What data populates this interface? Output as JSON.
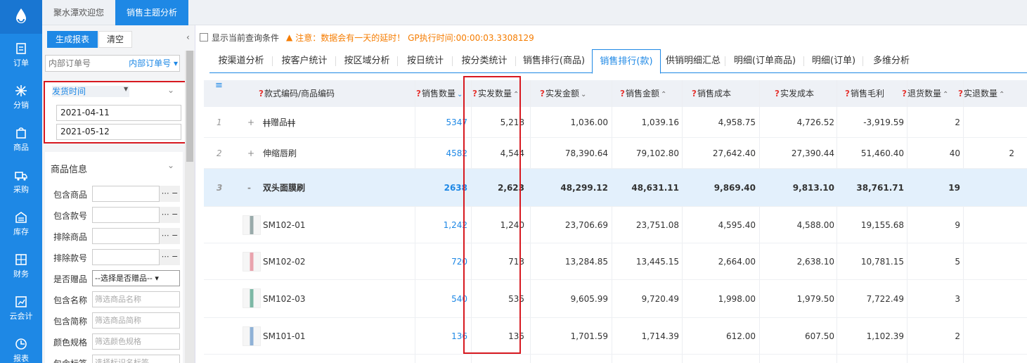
{
  "rail": {
    "items": [
      {
        "label": "订单",
        "icon": "order-icon"
      },
      {
        "label": "分销",
        "icon": "distribution-icon"
      },
      {
        "label": "商品",
        "icon": "product-icon"
      },
      {
        "label": "采购",
        "icon": "truck-icon"
      },
      {
        "label": "库存",
        "icon": "warehouse-icon"
      },
      {
        "label": "财务",
        "icon": "finance-icon"
      },
      {
        "label": "云会计",
        "icon": "accounting-icon"
      },
      {
        "label": "报表",
        "icon": "report-icon"
      }
    ]
  },
  "tabs": [
    "聚水潭欢迎您",
    "销售主题分析"
  ],
  "panel": {
    "generate_label": "生成报表",
    "clear_label": "清空",
    "order_placeholder": "内部订单号",
    "order_select": "内部订单号",
    "date_label": "发货时间",
    "date_from": "2021-04-11",
    "date_to": "2021-05-12",
    "product_info": "商品信息",
    "filters": [
      {
        "label": "包含商品",
        "placeholder": ""
      },
      {
        "label": "包含款号",
        "placeholder": ""
      },
      {
        "label": "排除商品",
        "placeholder": ""
      },
      {
        "label": "排除款号",
        "placeholder": ""
      },
      {
        "label": "是否赠品",
        "select": "--选择是否赠品--"
      },
      {
        "label": "包含名称",
        "placeholder": "筛选商品名称"
      },
      {
        "label": "包含简称",
        "placeholder": "筛选商品简称"
      },
      {
        "label": "颜色规格",
        "placeholder": "筛选颜色规格"
      },
      {
        "label": "包含标签",
        "placeholder": "选择标识名标签"
      }
    ]
  },
  "notice": {
    "checkbox_label": "显示当前查询条件",
    "warning": "注意：数据会有一天的延时！ GP执行时间:00:00:03.3308129"
  },
  "subtabs": [
    "按渠道分析",
    "按客户统计",
    "按区域分析",
    "按日统计",
    "按分类统计",
    "销售排行(商品)",
    "销售排行(款)",
    "供销明细汇总",
    "明细(订单商品)",
    "明细(订单)",
    "多维分析"
  ],
  "active_subtab": "销售排行(款)",
  "columns": [
    {
      "label": "款式编码/商品编码",
      "q": true
    },
    {
      "label": "销售数量",
      "q": true,
      "sort": "desc"
    },
    {
      "label": "实发数量",
      "q": true,
      "sort": "asc"
    },
    {
      "label": "实发金额",
      "q": true,
      "sort": "desc"
    },
    {
      "label": "销售金额",
      "q": true,
      "sort": "asc"
    },
    {
      "label": "销售成本",
      "q": true
    },
    {
      "label": "实发成本",
      "q": true
    },
    {
      "label": "销售毛利",
      "q": true
    },
    {
      "label": "退货数量",
      "q": true,
      "sort": "asc"
    },
    {
      "label": "实退数量",
      "q": true,
      "sort": "asc"
    }
  ],
  "rows": [
    {
      "idx": "1",
      "expand": "+",
      "code": "ǂǂ赠品ǂǂ",
      "sales_qty": "5347",
      "ship_qty": "5,218",
      "ship_amt": "1,036.00",
      "sales_amt": "1,039.16",
      "sales_cost": "4,958.75",
      "ship_cost": "4,726.52",
      "profit": "-3,919.59",
      "return_qty": "2",
      "real_return": ""
    },
    {
      "idx": "2",
      "expand": "+",
      "code": "伸缩唇刷",
      "sales_qty": "4582",
      "ship_qty": "4,544",
      "ship_amt": "78,390.64",
      "sales_amt": "79,102.80",
      "sales_cost": "27,642.40",
      "ship_cost": "27,390.44",
      "profit": "51,460.40",
      "return_qty": "40",
      "real_return": "2"
    },
    {
      "idx": "3",
      "expand": "-",
      "code": "双头面膜刷",
      "sales_qty": "2638",
      "ship_qty": "2,623",
      "ship_amt": "48,299.12",
      "sales_amt": "48,631.11",
      "sales_cost": "9,869.40",
      "ship_cost": "9,813.10",
      "profit": "38,761.71",
      "return_qty": "19",
      "real_return": ""
    },
    {
      "idx": "",
      "expand": "",
      "code": "SM102-01",
      "sales_qty": "1,242",
      "ship_qty": "1,240",
      "ship_amt": "23,706.69",
      "sales_amt": "23,751.08",
      "sales_cost": "4,595.40",
      "ship_cost": "4,588.00",
      "profit": "19,155.68",
      "return_qty": "9",
      "real_return": ""
    },
    {
      "idx": "",
      "expand": "",
      "code": "SM102-02",
      "sales_qty": "720",
      "ship_qty": "713",
      "ship_amt": "13,284.85",
      "sales_amt": "13,445.15",
      "sales_cost": "2,664.00",
      "ship_cost": "2,638.10",
      "profit": "10,781.15",
      "return_qty": "5",
      "real_return": ""
    },
    {
      "idx": "",
      "expand": "",
      "code": "SM102-03",
      "sales_qty": "540",
      "ship_qty": "535",
      "ship_amt": "9,605.99",
      "sales_amt": "9,720.49",
      "sales_cost": "1,998.00",
      "ship_cost": "1,979.50",
      "profit": "7,722.49",
      "return_qty": "3",
      "real_return": ""
    },
    {
      "idx": "",
      "expand": "",
      "code": "SM101-01",
      "sales_qty": "136",
      "ship_qty": "135",
      "ship_amt": "1,701.59",
      "sales_amt": "1,714.39",
      "sales_cost": "612.00",
      "ship_cost": "607.50",
      "profit": "1,102.39",
      "return_qty": "2",
      "real_return": ""
    }
  ],
  "colors": {
    "brand": "#1e88e5",
    "warning": "#f57c00",
    "highlight": "#d71920",
    "row_highlight": "#e3f0fc"
  }
}
